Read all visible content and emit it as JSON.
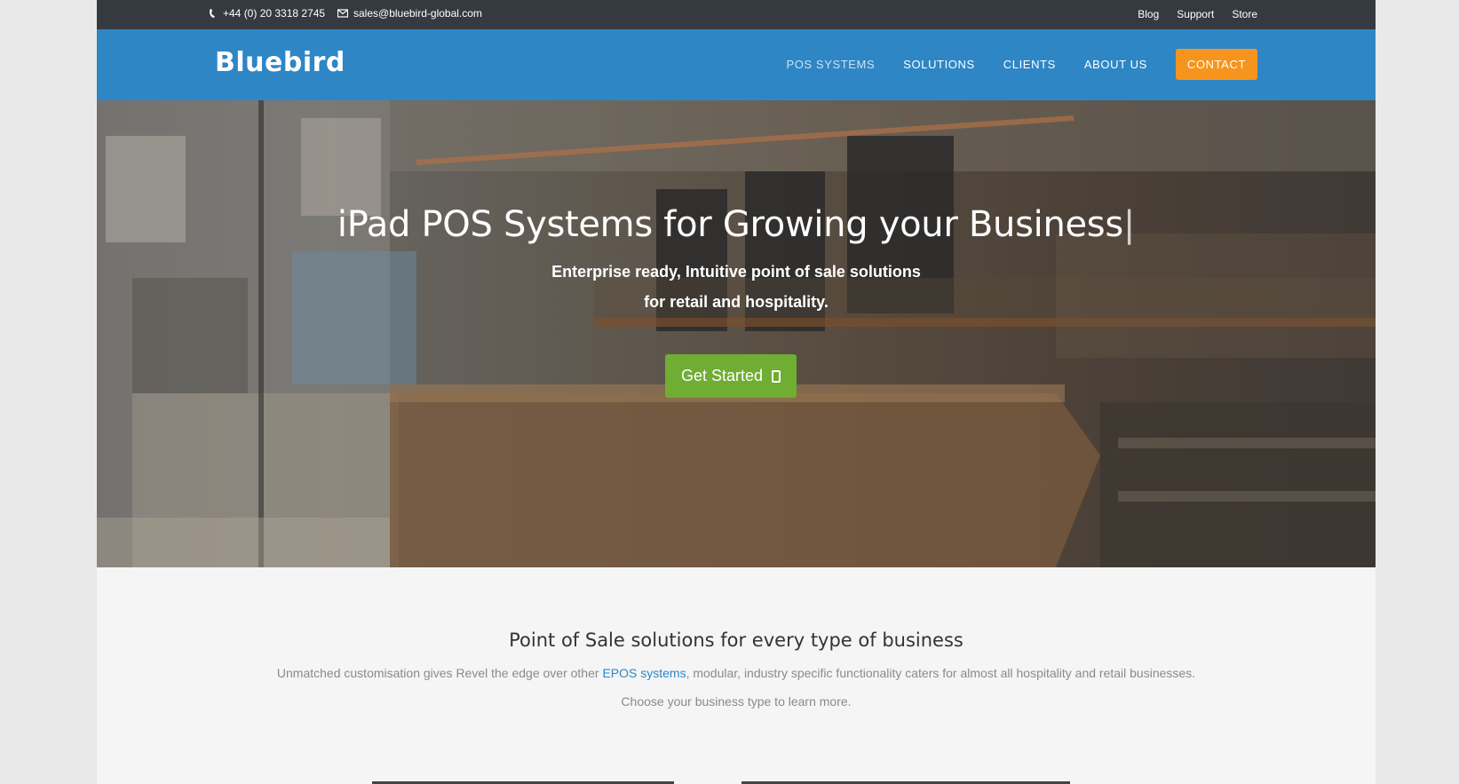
{
  "topbar": {
    "phone": "+44 (0) 20 3318 2745",
    "email": "sales@bluebird-global.com",
    "links": [
      "Blog",
      "Support",
      "Store"
    ]
  },
  "nav": {
    "logo": "Bluebird",
    "items": [
      "POS SYSTEMS",
      "SOLUTIONS",
      "CLIENTS",
      "ABOUT US"
    ],
    "active_item": "POS SYSTEMS",
    "contact": "CONTACT"
  },
  "hero": {
    "title": "iPad POS Systems for Growing your Business",
    "cursor": "|",
    "subtitle_line1": "Enterprise ready, Intuitive point of sale solutions",
    "subtitle_line2": "for retail and hospitality.",
    "button": "Get Started",
    "button_icon": "tablet-icon"
  },
  "content": {
    "title": "Point of Sale solutions for every type of business",
    "desc_before": "Unmatched customisation gives Revel the edge over other ",
    "desc_link": "EPOS systems",
    "desc_after": ", modular, industry specific functionality caters for almost all hospitality and retail businesses.",
    "cta": "Choose your business type to learn more."
  },
  "colors": {
    "topbar": "#343a40",
    "nav": "#2e86c5",
    "contact_button": "#f7941d",
    "get_started": "#6fad33",
    "page_bg": "#f5f5f5"
  }
}
